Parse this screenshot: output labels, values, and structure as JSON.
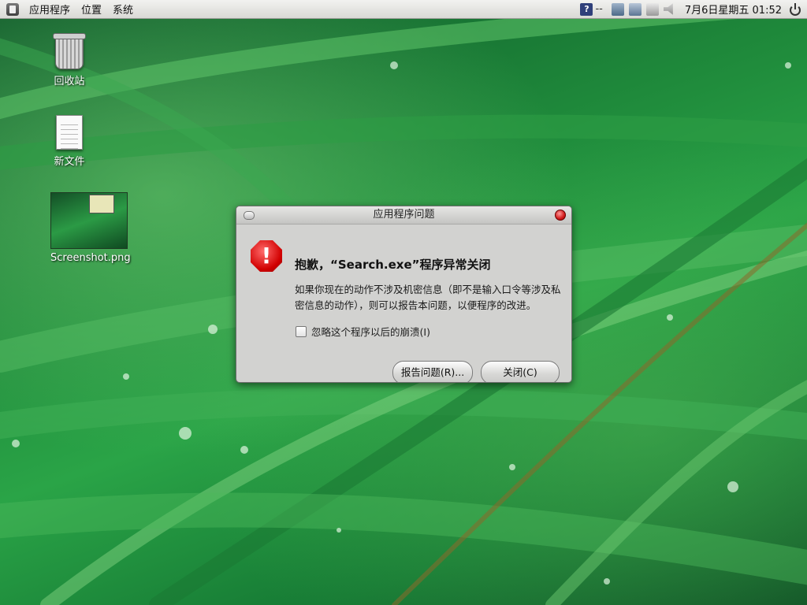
{
  "panel": {
    "menu": [
      "应用程序",
      "位置",
      "系统"
    ],
    "help_icon": "?",
    "help_text": "--",
    "clock": "7月6日星期五 01:52"
  },
  "desktop": {
    "icons": [
      {
        "label": "回收站",
        "icon": "trash-icon"
      },
      {
        "label": "新文件",
        "icon": "document-icon"
      },
      {
        "label": "Screenshot.png",
        "icon": "image-thumbnail-icon"
      }
    ]
  },
  "dialog": {
    "title": "应用程序问题",
    "error_symbol": "!",
    "heading": "抱歉，“Search.exe”程序异常关闭",
    "message": "如果你现在的动作不涉及机密信息（即不是输入口令等涉及私密信息的动作），则可以报告本问题，以便程序的改进。",
    "checkbox_label": "忽略这个程序以后的崩溃(I)",
    "checkbox_checked": false,
    "report_button": "报告问题(R)...",
    "close_button": "关闭(C)"
  },
  "colors": {
    "wallpaper": "#1f8a3b",
    "panel": "#e4e4e1",
    "dialog": "#d2d2d0",
    "error": "#d10000"
  }
}
